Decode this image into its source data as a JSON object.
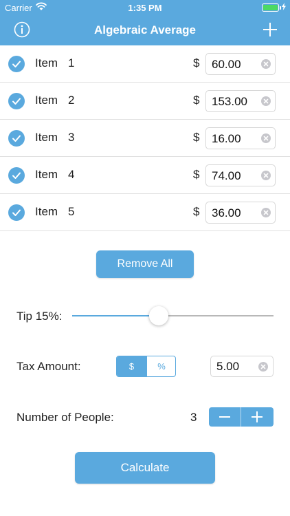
{
  "status_bar": {
    "carrier": "Carrier",
    "time": "1:35 PM",
    "battery_level": 1.0
  },
  "nav": {
    "title": "Algebraic Average",
    "left_icon": "info-icon",
    "right_icon": "plus-icon"
  },
  "currency_symbol": "$",
  "items": [
    {
      "name": "Item",
      "number": "1",
      "amount": "60.00"
    },
    {
      "name": "Item",
      "number": "2",
      "amount": "153.00"
    },
    {
      "name": "Item",
      "number": "3",
      "amount": "16.00"
    },
    {
      "name": "Item",
      "number": "4",
      "amount": "74.00"
    },
    {
      "name": "Item",
      "number": "5",
      "amount": "36.00"
    }
  ],
  "remove_all_label": "Remove All",
  "tip": {
    "label": "Tip 15%:",
    "slider_fraction": 0.43
  },
  "tax": {
    "label": "Tax Amount:",
    "options": [
      "$",
      "%"
    ],
    "selected": "$",
    "value": "5.00"
  },
  "people": {
    "label": "Number of People:",
    "count": "3"
  },
  "calculate_label": "Calculate",
  "colors": {
    "accent": "#5aa9de",
    "battery": "#4cd964",
    "clear_button": "#c7c7cc"
  }
}
